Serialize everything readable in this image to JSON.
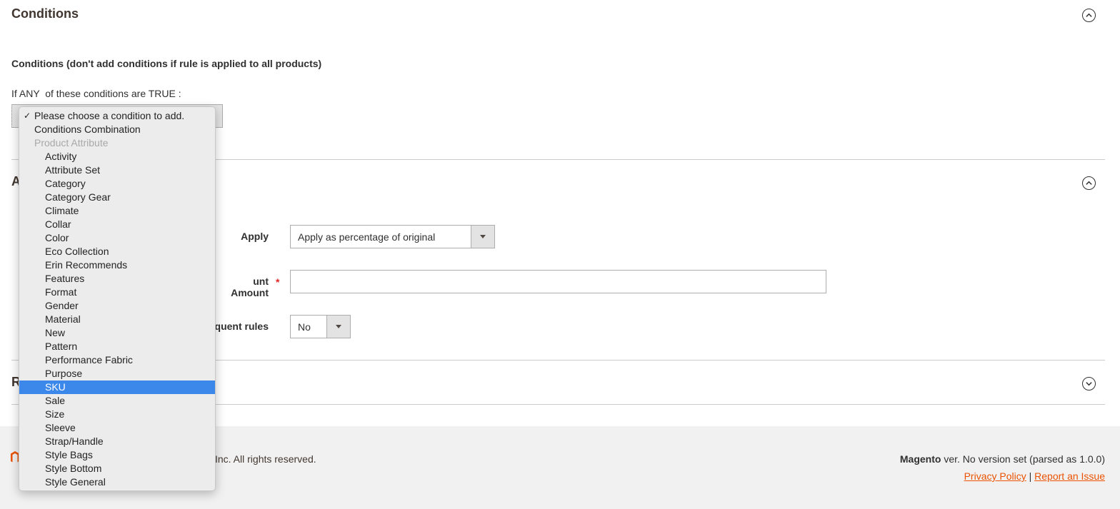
{
  "conditions_section": {
    "title": "Conditions",
    "description": "Conditions (don't add conditions if rule is applied to all products)",
    "if_prefix": "If",
    "aggregator": "ANY",
    "if_middle": "of these conditions are",
    "value": "TRUE",
    "if_suffix": ":"
  },
  "actions_section": {
    "title_visible": "A",
    "apply_label": "Apply",
    "apply_value": "Apply as percentage of original",
    "discount_label_visible": "unt Amount",
    "discount_required_marker": "*",
    "discount_value": "",
    "discard_label_visible": "quent rules",
    "discard_value": "No"
  },
  "related_section": {
    "title_visible": "R"
  },
  "footer": {
    "copyright_visible": "Inc. All rights reserved.",
    "brand": "Magento",
    "version_text": "ver. No version set (parsed as 1.0.0)",
    "privacy_link": "Privacy Policy",
    "separator": "|",
    "report_link": "Report an Issue"
  },
  "condition_dropdown": {
    "checkmark": "✓",
    "selected_option": "SKU",
    "items": [
      {
        "label": "Please choose a condition to add.",
        "kind": "top",
        "checked": true
      },
      {
        "label": "Conditions Combination",
        "kind": "top"
      },
      {
        "label": "Product Attribute",
        "kind": "group"
      },
      {
        "label": "Activity",
        "kind": "sub"
      },
      {
        "label": "Attribute Set",
        "kind": "sub"
      },
      {
        "label": "Category",
        "kind": "sub"
      },
      {
        "label": "Category Gear",
        "kind": "sub"
      },
      {
        "label": "Climate",
        "kind": "sub"
      },
      {
        "label": "Collar",
        "kind": "sub"
      },
      {
        "label": "Color",
        "kind": "sub"
      },
      {
        "label": "Eco Collection",
        "kind": "sub"
      },
      {
        "label": "Erin Recommends",
        "kind": "sub"
      },
      {
        "label": "Features",
        "kind": "sub"
      },
      {
        "label": "Format",
        "kind": "sub"
      },
      {
        "label": "Gender",
        "kind": "sub"
      },
      {
        "label": "Material",
        "kind": "sub"
      },
      {
        "label": "New",
        "kind": "sub"
      },
      {
        "label": "Pattern",
        "kind": "sub"
      },
      {
        "label": "Performance Fabric",
        "kind": "sub"
      },
      {
        "label": "Purpose",
        "kind": "sub"
      },
      {
        "label": "SKU",
        "kind": "sub"
      },
      {
        "label": "Sale",
        "kind": "sub"
      },
      {
        "label": "Size",
        "kind": "sub"
      },
      {
        "label": "Sleeve",
        "kind": "sub"
      },
      {
        "label": "Strap/Handle",
        "kind": "sub"
      },
      {
        "label": "Style Bags",
        "kind": "sub"
      },
      {
        "label": "Style Bottom",
        "kind": "sub"
      },
      {
        "label": "Style General",
        "kind": "sub"
      }
    ]
  },
  "colors": {
    "accent_link": "#eb5202",
    "selection": "#3b87ea",
    "required": "#e22626"
  },
  "icons": {
    "collapse": "chevron-up-circle-icon",
    "expand": "chevron-down-circle-icon"
  }
}
